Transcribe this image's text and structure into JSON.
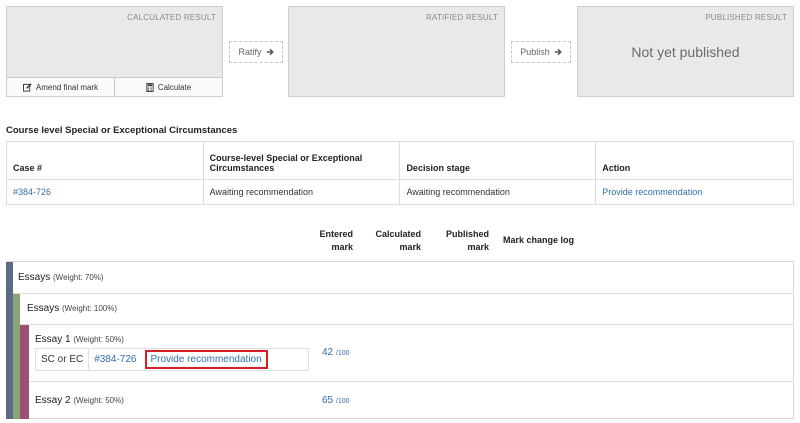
{
  "panels": {
    "calculated": {
      "label": "CALCULATED RESULT",
      "amend_label": "Amend final mark",
      "calculate_label": "Calculate"
    },
    "ratified": {
      "label": "RATIFIED RESULT"
    },
    "published": {
      "label": "PUBLISHED RESULT",
      "status": "Not yet published"
    }
  },
  "flow": {
    "ratify_label": "Ratify",
    "publish_label": "Publish"
  },
  "section": {
    "title": "Course level Special or Exceptional Circumstances",
    "headers": [
      "Case #",
      "Course-level Special or Exceptional Circumstances",
      "Decision stage",
      "Action"
    ],
    "row": {
      "case": "#384-726",
      "circumstances": "Awaiting recommendation",
      "stage": "Awaiting recommendation",
      "action": "Provide recommendation"
    }
  },
  "marks_header": {
    "entered": [
      "Entered",
      "mark"
    ],
    "calculated": [
      "Calculated",
      "mark"
    ],
    "published": [
      "Published",
      "mark"
    ],
    "log": "Mark change log"
  },
  "tree": {
    "level1": {
      "title": "Essays",
      "weight": "(Weight: 70%)"
    },
    "level2": {
      "title": "Essays",
      "weight": "(Weight: 100%)"
    },
    "essay1": {
      "title": "Essay 1",
      "weight": "(Weight: 50%)",
      "sc_label": "SC or EC",
      "case": "#384-726",
      "action": "Provide recommendation",
      "mark": "42",
      "out_of": "/100"
    },
    "essay2": {
      "title": "Essay 2",
      "weight": "(Weight: 50%)",
      "mark": "65",
      "out_of": "/100"
    }
  },
  "colors": {
    "bar_level1": "#5b6a86",
    "bar_level2": "#8aa676",
    "bar_level3": "#9c4f73",
    "highlight": "#d41f26",
    "link": "#2f6fae"
  },
  "icons": {
    "amend": "pencil-square-icon",
    "calculate": "calculator-icon",
    "arrow": "arrow-right-icon"
  }
}
